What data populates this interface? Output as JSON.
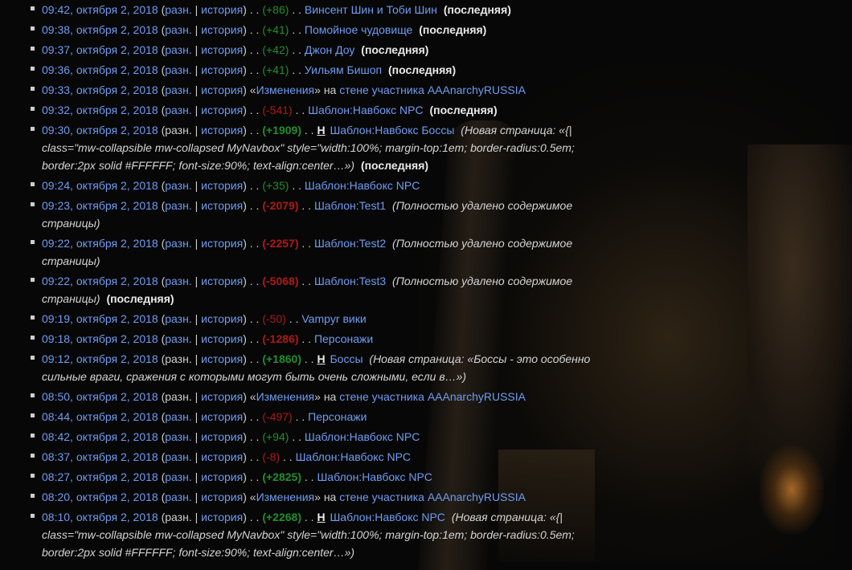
{
  "labels": {
    "diff": "разн.",
    "history": "история",
    "latest": "(последняя)",
    "on": "на",
    "wall_prefix": "стене участника",
    "changes": "Изменения",
    "dots": ". .",
    "new_flag": "Н"
  },
  "entries": [
    {
      "time": "09:42, октября 2, 2018",
      "diff_link": true,
      "delta": "(+86)",
      "delta_type": "pos",
      "title": "Винсент Шин и Тоби Шин",
      "latest": true
    },
    {
      "time": "09:38, октября 2, 2018",
      "diff_link": true,
      "delta": "(+41)",
      "delta_type": "pos",
      "title": "Помойное чудовище",
      "latest": true
    },
    {
      "time": "09:37, октября 2, 2018",
      "diff_link": true,
      "delta": "(+42)",
      "delta_type": "pos",
      "title": "Джон Доу",
      "latest": true
    },
    {
      "time": "09:36, октября 2, 2018",
      "diff_link": true,
      "delta": "(+41)",
      "delta_type": "pos",
      "title": "Уильям Бишоп",
      "latest": true
    },
    {
      "time": "09:33, октября 2, 2018",
      "diff_link": true,
      "wall": true,
      "wall_user": "AAAnarchyRUSSIA"
    },
    {
      "time": "09:32, октября 2, 2018",
      "diff_link": true,
      "delta": "(-541)",
      "delta_type": "neg",
      "title": "Шаблон:Навбокс NPC",
      "latest": true
    },
    {
      "time": "09:30, октября 2, 2018",
      "diff_link": false,
      "delta": "(+1909)",
      "delta_type": "pos_bold",
      "new": true,
      "title": "Шаблон:Навбокс Боссы",
      "summary": "(Новая страница: «{| class=\"mw-collapsible mw-collapsed MyNavbox\" style=\"width:100%; margin-top:1em; border-radius:0.5em; border:2px solid #FFFFFF; font-size:90%; text-align:center…»)",
      "latest": true
    },
    {
      "time": "09:24, октября 2, 2018",
      "diff_link": true,
      "delta": "(+35)",
      "delta_type": "pos",
      "title": "Шаблон:Навбокс NPC"
    },
    {
      "time": "09:23, октября 2, 2018",
      "diff_link": true,
      "delta": "(-2079)",
      "delta_type": "neg_bold",
      "title": "Шаблон:Test1",
      "summary": "(Полностью удалено содержимое страницы)"
    },
    {
      "time": "09:22, октября 2, 2018",
      "diff_link": true,
      "delta": "(-2257)",
      "delta_type": "neg_bold",
      "title": "Шаблон:Test2",
      "summary": "(Полностью удалено содержимое страницы)"
    },
    {
      "time": "09:22, октября 2, 2018",
      "diff_link": true,
      "delta": "(-5068)",
      "delta_type": "neg_bold",
      "title": "Шаблон:Test3",
      "summary": "(Полностью удалено содержимое страницы)",
      "latest": true
    },
    {
      "time": "09:19, октября 2, 2018",
      "diff_link": true,
      "delta": "(-50)",
      "delta_type": "neg",
      "title": "Vampyr вики"
    },
    {
      "time": "09:18, октября 2, 2018",
      "diff_link": true,
      "delta": "(-1286)",
      "delta_type": "neg_bold",
      "title": "Персонажи"
    },
    {
      "time": "09:12, октября 2, 2018",
      "diff_link": false,
      "delta": "(+1860)",
      "delta_type": "pos_bold",
      "new": true,
      "title": "Боссы",
      "summary": "(Новая страница: «Боссы - это особенно сильные враги, сражения с которыми могут быть очень сложными, если в…»)"
    },
    {
      "time": "08:50, октября 2, 2018",
      "diff_link": false,
      "wall": true,
      "wall_user": "AAAnarchyRUSSIA"
    },
    {
      "time": "08:44, октября 2, 2018",
      "diff_link": true,
      "delta": "(-497)",
      "delta_type": "neg",
      "title": "Персонажи"
    },
    {
      "time": "08:42, октября 2, 2018",
      "diff_link": true,
      "delta": "(+94)",
      "delta_type": "pos",
      "title": "Шаблон:Навбокс NPC"
    },
    {
      "time": "08:37, октября 2, 2018",
      "diff_link": true,
      "delta": "(-8)",
      "delta_type": "neg",
      "title": "Шаблон:Навбокс NPC"
    },
    {
      "time": "08:27, октября 2, 2018",
      "diff_link": true,
      "delta": "(+2825)",
      "delta_type": "pos_bold",
      "title": "Шаблон:Навбокс NPC"
    },
    {
      "time": "08:20, октября 2, 2018",
      "diff_link": true,
      "wall": true,
      "wall_user": "AAAnarchyRUSSIA"
    },
    {
      "time": "08:10, октября 2, 2018",
      "diff_link": false,
      "delta": "(+2268)",
      "delta_type": "pos_bold",
      "new": true,
      "title": "Шаблон:Навбокс NPC",
      "summary": "(Новая страница: «{| class=\"mw-collapsible mw-collapsed MyNavbox\" style=\"width:100%; margin-top:1em; border-radius:0.5em; border:2px solid #FFFFFF; font-size:90%; text-align:center…»)"
    }
  ],
  "colors": {
    "link": "#6f9cf2",
    "positive": "#1f8f2c",
    "negative": "#b01818",
    "text": "#cfcfcf"
  }
}
